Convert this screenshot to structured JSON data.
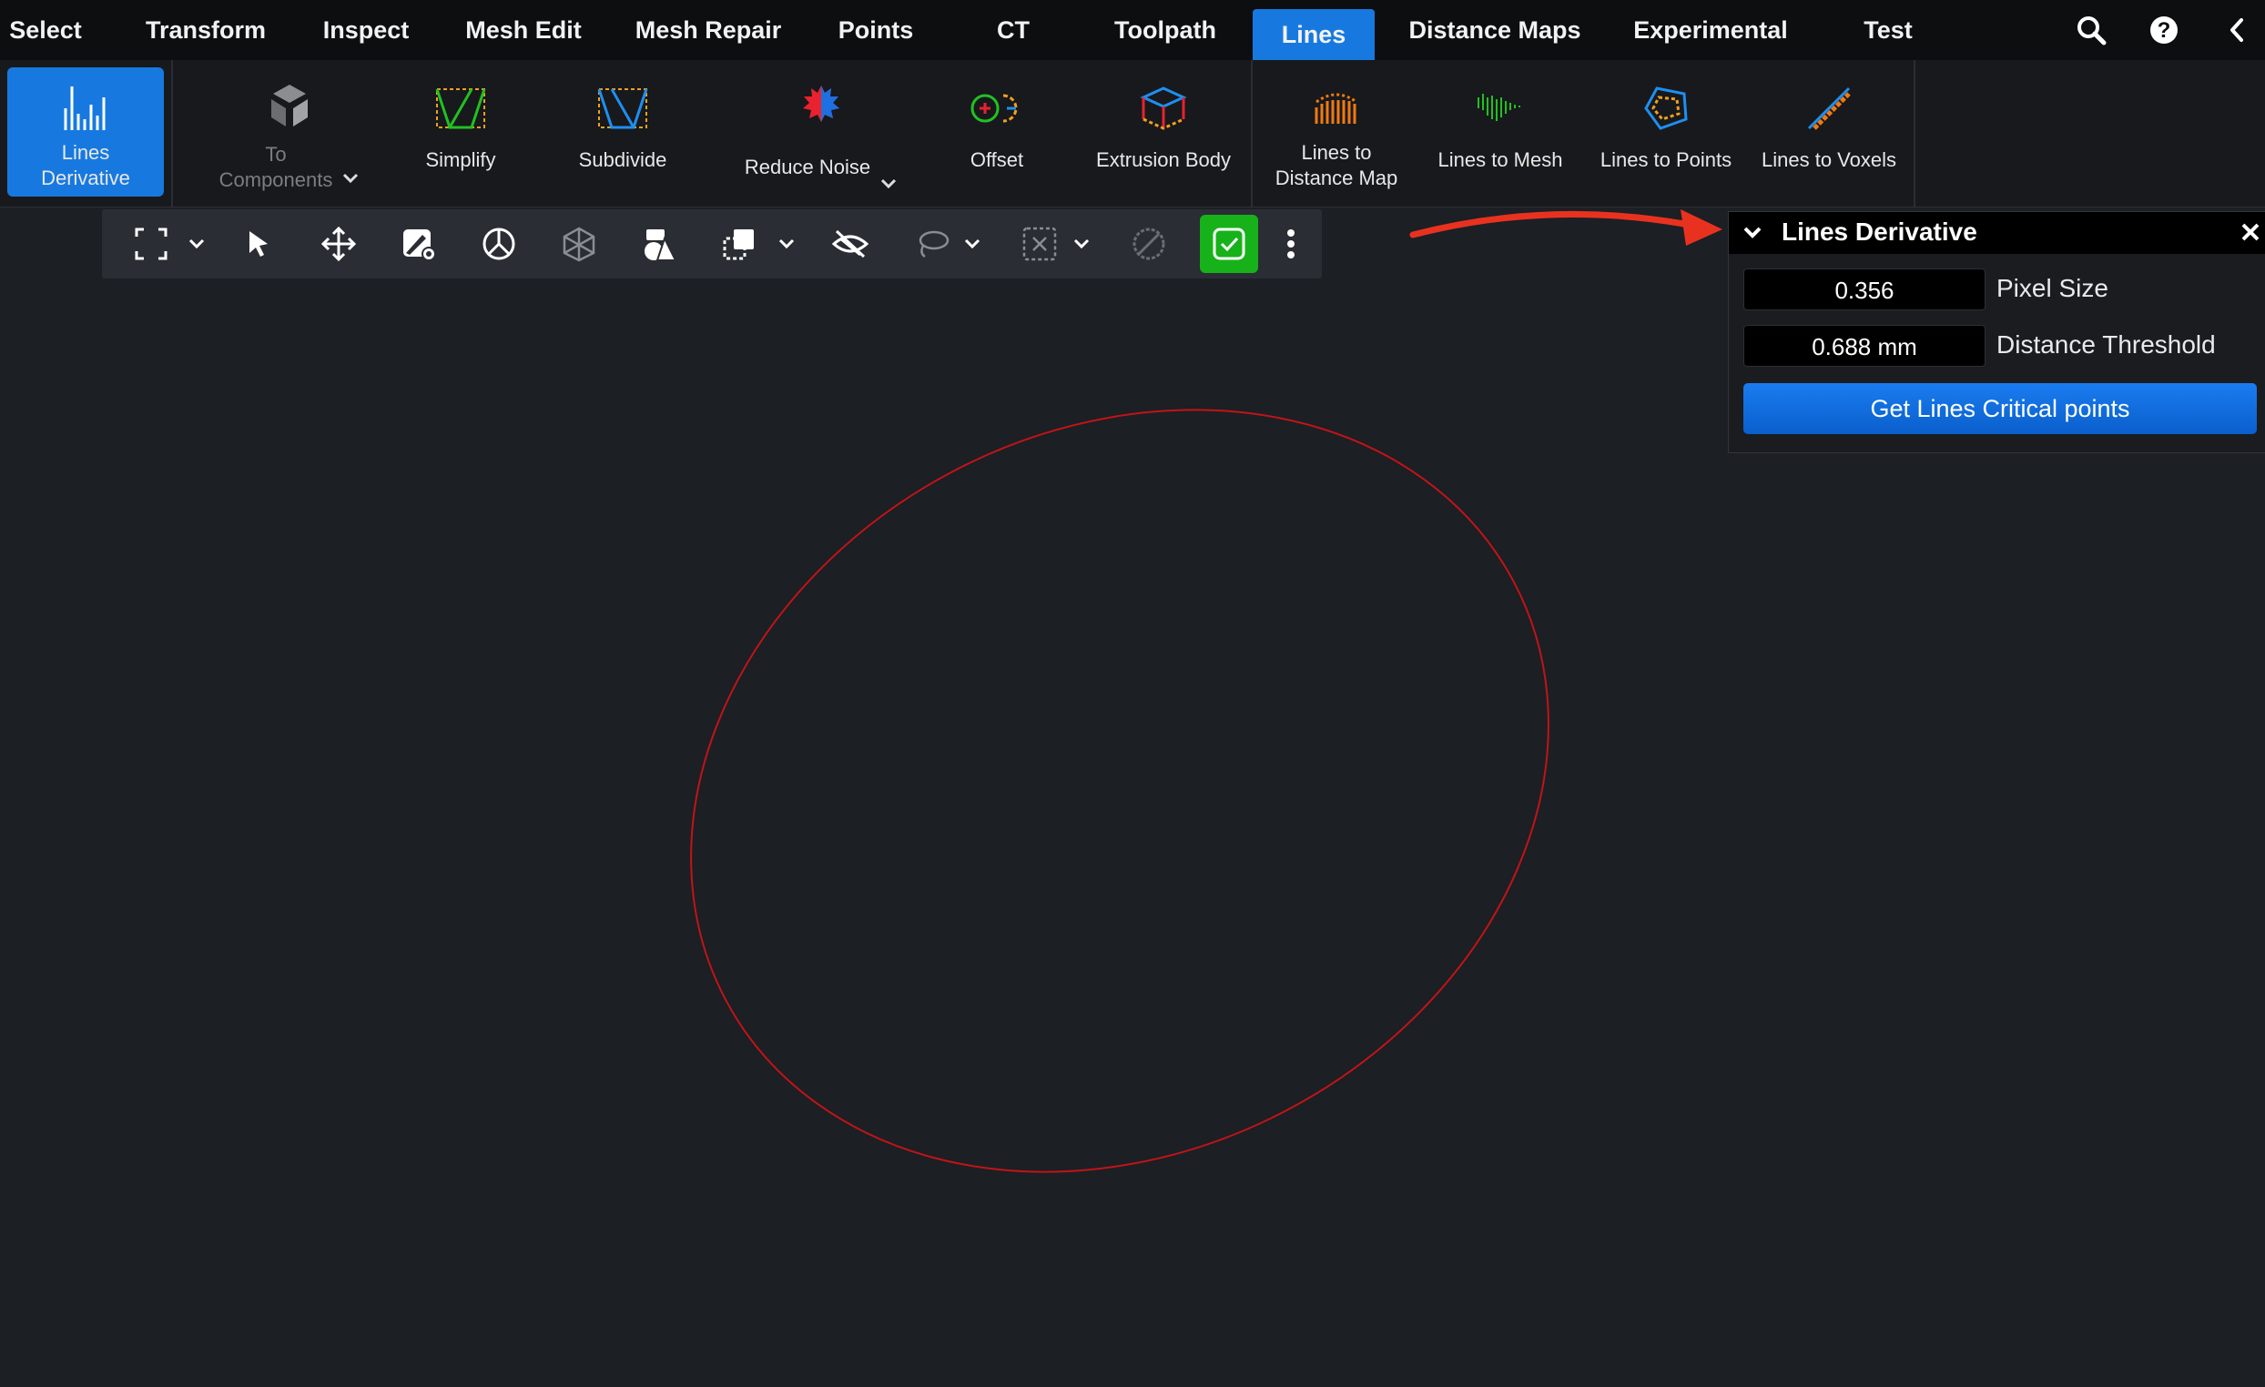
{
  "tabs": [
    {
      "label": "Select"
    },
    {
      "label": "Transform"
    },
    {
      "label": "Inspect"
    },
    {
      "label": "Mesh Edit"
    },
    {
      "label": "Mesh Repair"
    },
    {
      "label": "Points"
    },
    {
      "label": "CT"
    },
    {
      "label": "Toolpath"
    },
    {
      "label": "Lines",
      "active": true
    },
    {
      "label": "Distance Maps"
    },
    {
      "label": "Experimental"
    },
    {
      "label": "Test"
    }
  ],
  "topbar_icons": [
    "search-icon",
    "help-icon",
    "collapse-icon"
  ],
  "ribbon": {
    "items": [
      {
        "label": "Lines\nDerivative",
        "icon": "lines-derivative-icon",
        "active": true
      },
      {
        "label": "To\nComponents",
        "icon": "to-components-icon",
        "disabled": true,
        "dropdown": true
      },
      {
        "label": "Simplify",
        "icon": "simplify-icon"
      },
      {
        "label": "Subdivide",
        "icon": "subdivide-icon"
      },
      {
        "label": "Reduce Noise",
        "icon": "reduce-noise-icon",
        "dropdown": true
      },
      {
        "label": "Offset",
        "icon": "offset-icon"
      },
      {
        "label": "Extrusion Body",
        "icon": "extrusion-body-icon"
      },
      {
        "label": "Lines to\nDistance Map",
        "icon": "lines-to-distance-map-icon"
      },
      {
        "label": "Lines to Mesh",
        "icon": "lines-to-mesh-icon"
      },
      {
        "label": "Lines to Points",
        "icon": "lines-to-points-icon"
      },
      {
        "label": "Lines to Voxels",
        "icon": "lines-to-voxels-icon"
      }
    ]
  },
  "viewport_toolbar": [
    "fit-view-icon",
    "select-cursor-icon",
    "move-icon",
    "paint-settings-icon",
    "peace-icon",
    "wireframe-cube-icon",
    "shapes-icon",
    "copy-icon",
    "hide-icon",
    "lasso-icon",
    "deselect-box-icon",
    "cancel-icon",
    "confirm-icon",
    "more-icon"
  ],
  "panel": {
    "title": "Lines Derivative",
    "fields": [
      {
        "value": "0.356",
        "label": "Pixel Size"
      },
      {
        "value": "0.688 mm",
        "label": "Distance Threshold"
      }
    ],
    "button": "Get Lines Critical points"
  },
  "colors": {
    "accent": "#1779e0",
    "curve": "#c01418",
    "confirm": "#17b21a",
    "arrow": "#e8321f"
  }
}
